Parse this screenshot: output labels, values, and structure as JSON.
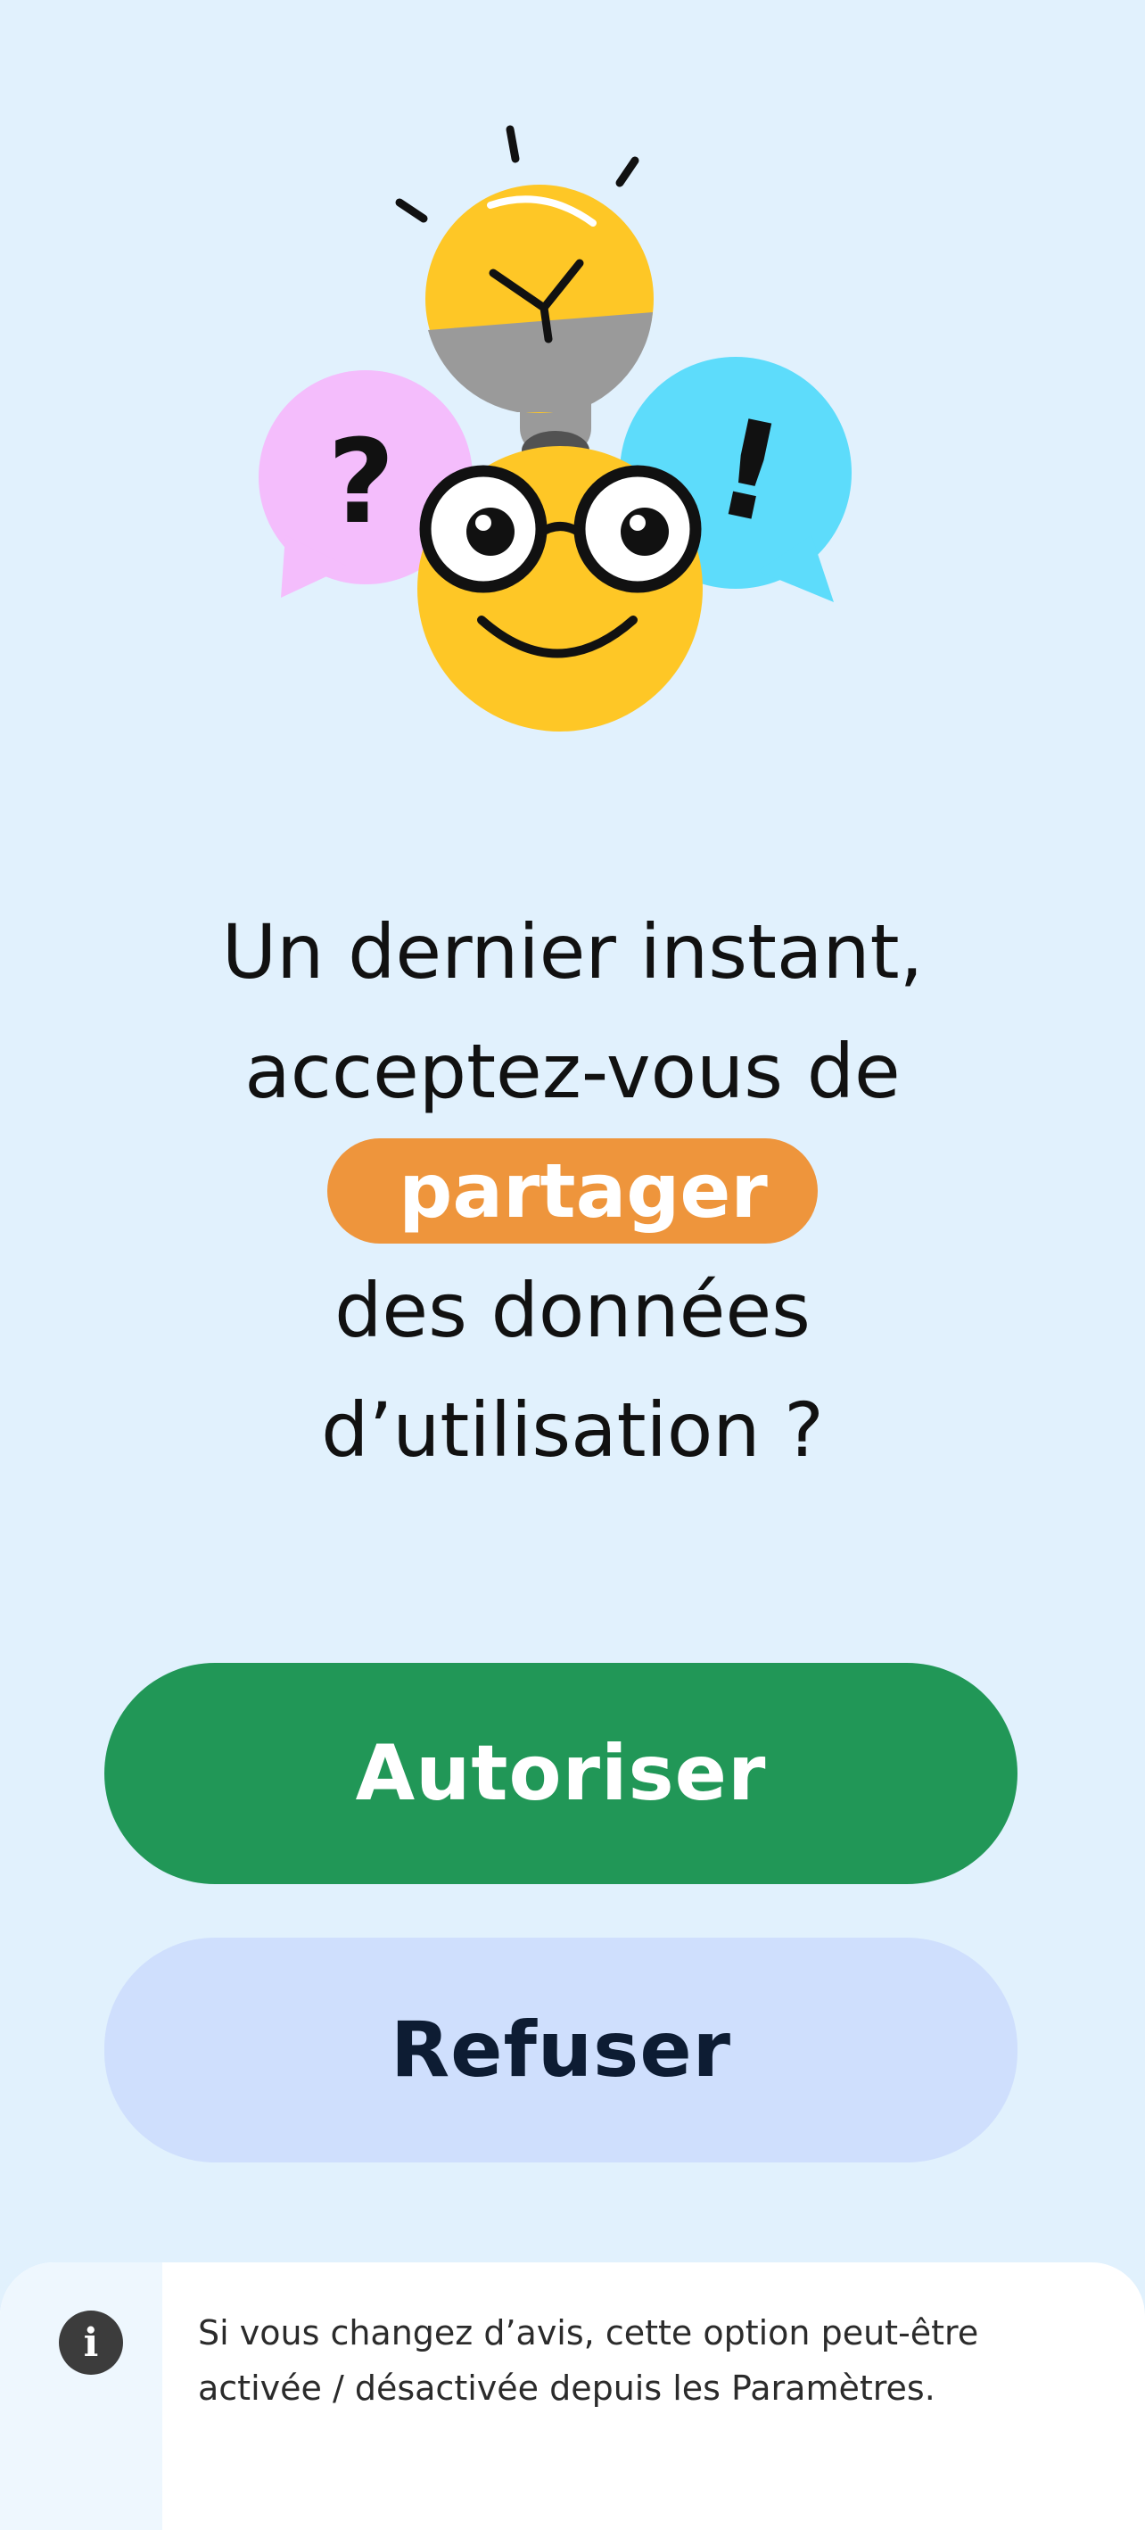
{
  "headline": {
    "line1": "Un dernier instant,",
    "line2": "acceptez-vous de",
    "highlight": "partager",
    "line3": "des données",
    "line4": "d’utilisation ?"
  },
  "buttons": {
    "allow_label": "Autoriser",
    "refuse_label": "Refuser"
  },
  "info": {
    "icon_glyph": "i",
    "text": "Si vous changez d’avis, cette option peut-être activée / désactivée depuis les Paramètres."
  },
  "colors": {
    "background": "#e1f1fd",
    "highlight_pill": "#ee953c",
    "allow_button": "#219757",
    "refuse_button": "#cfdffd",
    "refuse_text": "#0d1c33"
  },
  "illustration": {
    "icons": [
      "lightbulb-icon",
      "question-bubble-icon",
      "exclamation-bubble-icon",
      "smiley-glasses-icon"
    ],
    "question_mark": "?",
    "exclamation_mark": "!"
  }
}
